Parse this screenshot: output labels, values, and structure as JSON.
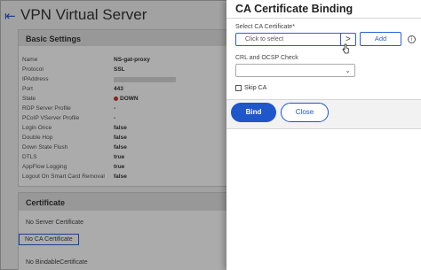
{
  "background_page": {
    "back_icon": "back-arrow-icon",
    "title": "VPN Virtual Server",
    "basic_settings": {
      "header": "Basic Settings",
      "fields": [
        {
          "label": "Name",
          "value": "NS-gat-proxy"
        },
        {
          "label": "Protocol",
          "value": "SSL"
        },
        {
          "label": "IPAddress",
          "value": ""
        },
        {
          "label": "Port",
          "value": "443"
        },
        {
          "label": "State",
          "value": "DOWN"
        },
        {
          "label": "RDP Server Profile",
          "value": "-"
        },
        {
          "label": "PCoIP VServer Profile",
          "value": "-"
        },
        {
          "label": "Login Once",
          "value": "false"
        },
        {
          "label": "Double Hop",
          "value": "false"
        },
        {
          "label": "Down State Flush",
          "value": "false"
        },
        {
          "label": "DTLS",
          "value": "true"
        },
        {
          "label": "AppFlow Logging",
          "value": "true"
        },
        {
          "label": "Logout On Smart Card Removal",
          "value": "false"
        }
      ]
    },
    "certificate": {
      "header": "Certificate",
      "server_certificate": "No Server Certificate",
      "ca_certificate": "No CA Certificate",
      "bindable_certificate": "No BindableCertificate"
    }
  },
  "dialog": {
    "title": "CA Certificate Binding",
    "select_ca_label": "Select CA Certificate*",
    "select_ca_placeholder": "Click to select",
    "select_ca_chevron": ">",
    "add_label": "Add",
    "info_icon_text": "i",
    "crl_label": "CRL and OCSP Check",
    "crl_value": "",
    "skip_ca_label": "Skip CA",
    "skip_ca_checked": false,
    "bind_label": "Bind",
    "close_label": "Close"
  },
  "colors": {
    "accent": "#1f56c9",
    "state_down": "#c0392b"
  }
}
